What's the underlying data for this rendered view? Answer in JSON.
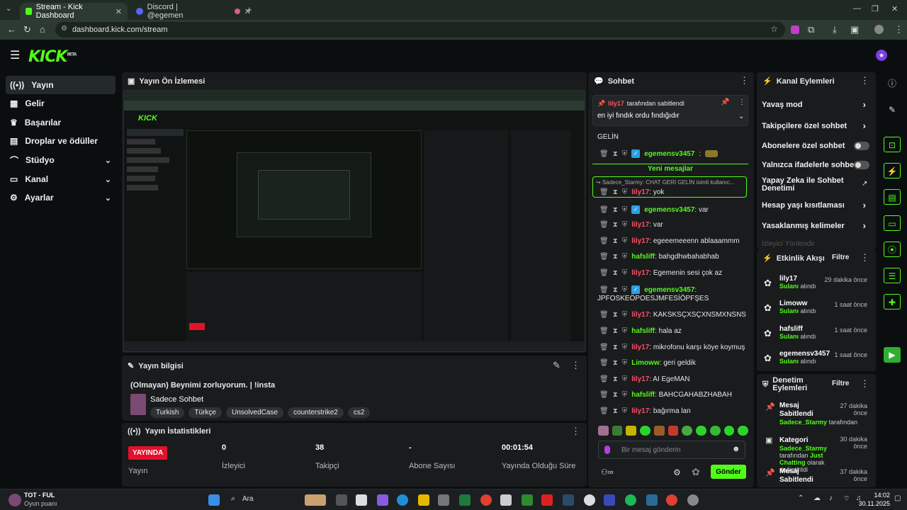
{
  "browser": {
    "tabs": [
      {
        "title": "Stream - Kick Dashboard"
      },
      {
        "title": "Discord | @egemen"
      }
    ],
    "url": "dashboard.kick.com/stream"
  },
  "app": {
    "logo": "KICK",
    "logo_sup": "BETA"
  },
  "sidebar": {
    "items": [
      {
        "label": "Yayın",
        "icon": "broadcast-icon"
      },
      {
        "label": "Gelir",
        "icon": "revenue-icon"
      },
      {
        "label": "Başarılar",
        "icon": "trophy-icon"
      },
      {
        "label": "Droplar ve ödüller",
        "icon": "drops-icon"
      },
      {
        "label": "Stüdyo",
        "icon": "studio-icon"
      },
      {
        "label": "Kanal",
        "icon": "channel-icon"
      },
      {
        "label": "Ayarlar",
        "icon": "settings-icon"
      }
    ]
  },
  "preview": {
    "title": "Yayın Ön İzlemesi"
  },
  "stream_info": {
    "title": "Yayın bilgisi",
    "stream_title": "(Olmayan) Beynimi zorluyorum. | !insta",
    "category": "Sadece Sohbet",
    "tags": [
      "Turkish",
      "Türkçe",
      "UnsolvedCase",
      "counterstrike2",
      "cs2"
    ]
  },
  "stats": {
    "title": "Yayın İstatistikleri",
    "live_label": "YAYINDA",
    "cols": [
      {
        "value": "",
        "label": "Yayın"
      },
      {
        "value": "0",
        "label": "İzleyici"
      },
      {
        "value": "38",
        "label": "Takipçi"
      },
      {
        "value": "-",
        "label": "Abone Sayısı"
      },
      {
        "value": "00:01:54",
        "label": "Yayında Olduğu Süre"
      }
    ]
  },
  "chat": {
    "title": "Sohbet",
    "pinned_by": "lily17",
    "pinned_suffix": "tarafından sabitlendi",
    "pinned_text": "en iyi fındık ordu fındığıdır",
    "gelin": "GELİN",
    "new_messages": "Yeni mesajlar",
    "reply_preview": "Sadece_Starmy: CHAT GERİ GELİN isimli kullanıc...",
    "messages": [
      {
        "user": "egemensv3457",
        "color": "green",
        "text": "",
        "badge": true,
        "emote": true
      },
      {
        "user": "lily17",
        "color": "red",
        "text": "yok"
      },
      {
        "user": "egemensv3457",
        "color": "green",
        "text": "var",
        "badge": true
      },
      {
        "user": "lily17",
        "color": "red",
        "text": "var"
      },
      {
        "user": "lily17",
        "color": "red",
        "text": "egeeemeeenn ablaaammm"
      },
      {
        "user": "hafsliff",
        "color": "green",
        "text": "bahgdhwbahabhab"
      },
      {
        "user": "lily17",
        "color": "red",
        "text": "Egemenin sesi çok az"
      },
      {
        "user": "egemensv3457",
        "color": "green",
        "text": "",
        "badge": true
      },
      {
        "user": "lily17",
        "color": "red",
        "text": "KAKSKSÇXSÇXNSMXNSNS"
      },
      {
        "user": "hafsliff",
        "color": "green",
        "text": "hala az"
      },
      {
        "user": "lily17",
        "color": "red",
        "text": "mikrofonu karşı köye koymuş"
      },
      {
        "user": "Limoww",
        "color": "green",
        "text": "geri geldik"
      },
      {
        "user": "lily17",
        "color": "red",
        "text": "AI EgeMAN"
      },
      {
        "user": "hafsliff",
        "color": "green",
        "text": "BAHCGAHABZHABAH"
      },
      {
        "user": "lily17",
        "color": "red",
        "text": "bağırma lan"
      }
    ],
    "wrap_line": "JPFOSKEÖPOESJMFESİÖPFŞES",
    "input_placeholder": "Bir mesaj gönderin",
    "send_label": "Gönder"
  },
  "channel_actions": {
    "title": "Kanal Eylemleri",
    "rows": [
      {
        "label": "Yavaş mod",
        "control": "chevron"
      },
      {
        "label": "Takipçilere özel sohbet",
        "control": "chevron"
      },
      {
        "label": "Abonelere özel sohbet",
        "control": "toggle"
      },
      {
        "label": "Yalnızca ifadelerle sohbet",
        "control": "toggle"
      },
      {
        "label": "Yapay Zeka ile Sohbet Denetimi",
        "control": "external"
      },
      {
        "label": "Hesap yaşı kısıtlaması",
        "control": "chevron"
      },
      {
        "label": "Yasaklanmış kelimeler",
        "control": "chevron"
      }
    ],
    "faded": "İzleyici Yönlendir"
  },
  "activity": {
    "title": "Etkinlik Akışı",
    "filter": "Filtre",
    "items": [
      {
        "name": "lily17",
        "action": "Sulanı",
        "suffix": "alındı",
        "time": "29 dakika önce"
      },
      {
        "name": "Limoww",
        "action": "Sulanı",
        "suffix": "alındı",
        "time": "1 saat önce"
      },
      {
        "name": "hafsliff",
        "action": "Sulanı",
        "suffix": "alındı",
        "time": "1 saat önce"
      },
      {
        "name": "egemensv3457",
        "action": "Sulanı",
        "suffix": "alındı",
        "time": "1 saat önce"
      }
    ]
  },
  "moderation": {
    "title": "Denetim Eylemleri",
    "filter": "Filtre",
    "items": [
      {
        "title": "Mesaj Sabitlendi",
        "user": "Sadece_Starmy",
        "detail": "tarafından",
        "time": "27 dakika önce"
      },
      {
        "title": "Kategori",
        "user": "Sadece_Starmy",
        "detail": "tarafından",
        "detail2": "Just Chatting",
        "detail3": "olarak değiştirildi",
        "time": "30 dakika önce"
      },
      {
        "title": "Mesaj Sabitlendi",
        "user": "",
        "detail": "",
        "time": "37 dakika önce"
      }
    ]
  },
  "taskbar": {
    "game_title": "TOT - FUL",
    "game_sub": "Oyun puanı",
    "search": "Ara",
    "time": "14:02",
    "date": "30.11.2025"
  },
  "colors": {
    "accent": "#53fc18",
    "live": "#e4112c",
    "user_red": "#ff5166",
    "panel": "#191b1d"
  }
}
